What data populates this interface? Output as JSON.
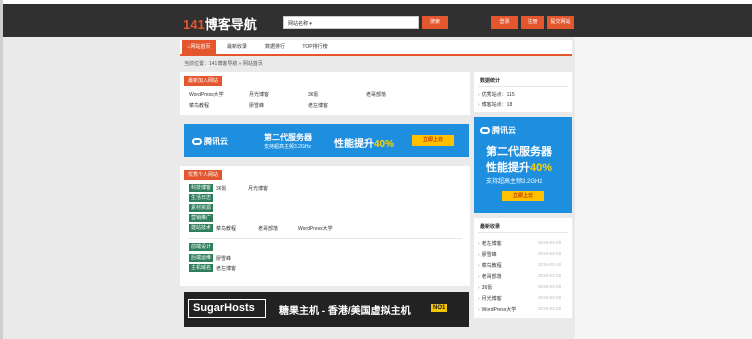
{
  "header": {
    "logo_num": "141",
    "logo_text": "博客导航",
    "search_select": "网站名称",
    "search_btn": "搜索",
    "login": "登录",
    "register": "注册",
    "submit_site": "提交网站"
  },
  "nav": {
    "tabs": [
      "⌂网站首页",
      "最新收录",
      "数据排行",
      "TOP排行榜"
    ]
  },
  "breadcrumb": "当前位置：141博客导航 » 网站首页",
  "recent": {
    "title": "最新加入网站",
    "links": [
      "WordPress大学",
      "月光博客",
      "36氪",
      "老哥部落",
      "菜鸟教程",
      "廖雪峰",
      "老左博客"
    ]
  },
  "tencent_banner": {
    "logo": "腾讯云",
    "main": "第二代服务器",
    "sub": "支持超高主频3.2GHz",
    "perf": "性能提升",
    "pct": "40%",
    "btn": "立即上云"
  },
  "personal": {
    "title": "优秀个人网站",
    "categories": [
      {
        "name": "科技博客",
        "links": [
          "36氪",
          "月光博客"
        ]
      },
      {
        "name": "生活日志",
        "links": []
      },
      {
        "name": "素材资源",
        "links": []
      },
      {
        "name": "营销推广",
        "links": []
      },
      {
        "name": "建站技术",
        "links": [
          "菜鸟教程",
          "老哥部落",
          "WordPress大学"
        ]
      },
      {
        "name": "前端设计",
        "links": []
      },
      {
        "name": "后端运维",
        "links": [
          "廖雪峰"
        ]
      },
      {
        "name": "主机域名",
        "links": [
          "老左博客"
        ]
      }
    ]
  },
  "sugar": {
    "logo": "SugarHosts",
    "slogan": "糖果主机 - 香港/美国虚拟主机",
    "badge": "NO1"
  },
  "sidebar": {
    "stats_title": "数据统计",
    "stats": [
      "优秀站点：115",
      "博客站点：18"
    ],
    "latest_title": "最新收录",
    "latest": [
      {
        "name": "老左博客",
        "date": "2019-03-28"
      },
      {
        "name": "廖雪峰",
        "date": "2019-03-28"
      },
      {
        "name": "菜鸟教程",
        "date": "2019-03-28"
      },
      {
        "name": "老哥部落",
        "date": "2019-03-28"
      },
      {
        "name": "36氪",
        "date": "2019-03-28"
      },
      {
        "name": "月光博客",
        "date": "2019-03-28"
      },
      {
        "name": "WordPress大学",
        "date": "2019-03-28"
      }
    ]
  },
  "colors": {
    "accent": "#e4572e",
    "header_bg": "#303030",
    "tag_green": "#2e7d5b",
    "banner_blue": "#1e8fdf"
  }
}
